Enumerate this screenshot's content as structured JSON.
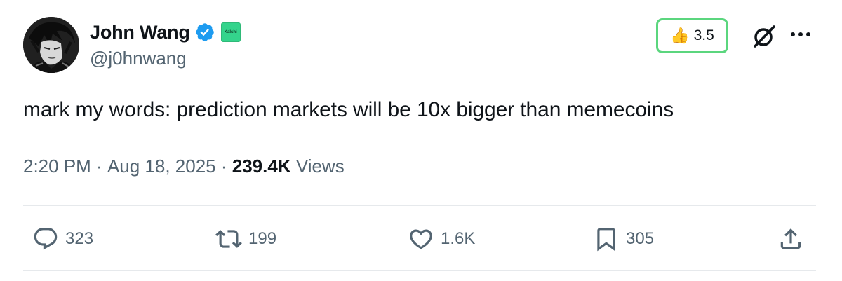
{
  "author": {
    "display_name": "John Wang",
    "handle": "@j0hnwang",
    "verified": true,
    "affiliation_badge": "Kalshi",
    "affiliation_color": "#34d48c"
  },
  "header_actions": {
    "rating_emoji": "👍",
    "rating_value": "3.5",
    "rating_border_color": "#5bd67e",
    "grok_icon": "grok-icon",
    "more_icon": "more-icon"
  },
  "tweet": {
    "text": "mark my words: prediction markets will be 10x bigger than memecoins",
    "time": "2:20 PM",
    "date": "Aug 18, 2025",
    "views_count": "239.4K",
    "views_label": "Views",
    "separator": " · "
  },
  "engagement": {
    "replies": "323",
    "reposts": "199",
    "likes": "1.6K",
    "bookmarks": "305"
  },
  "colors": {
    "primary_text": "#0f1419",
    "secondary_text": "#536471",
    "verified_blue": "#1d9bf0"
  }
}
